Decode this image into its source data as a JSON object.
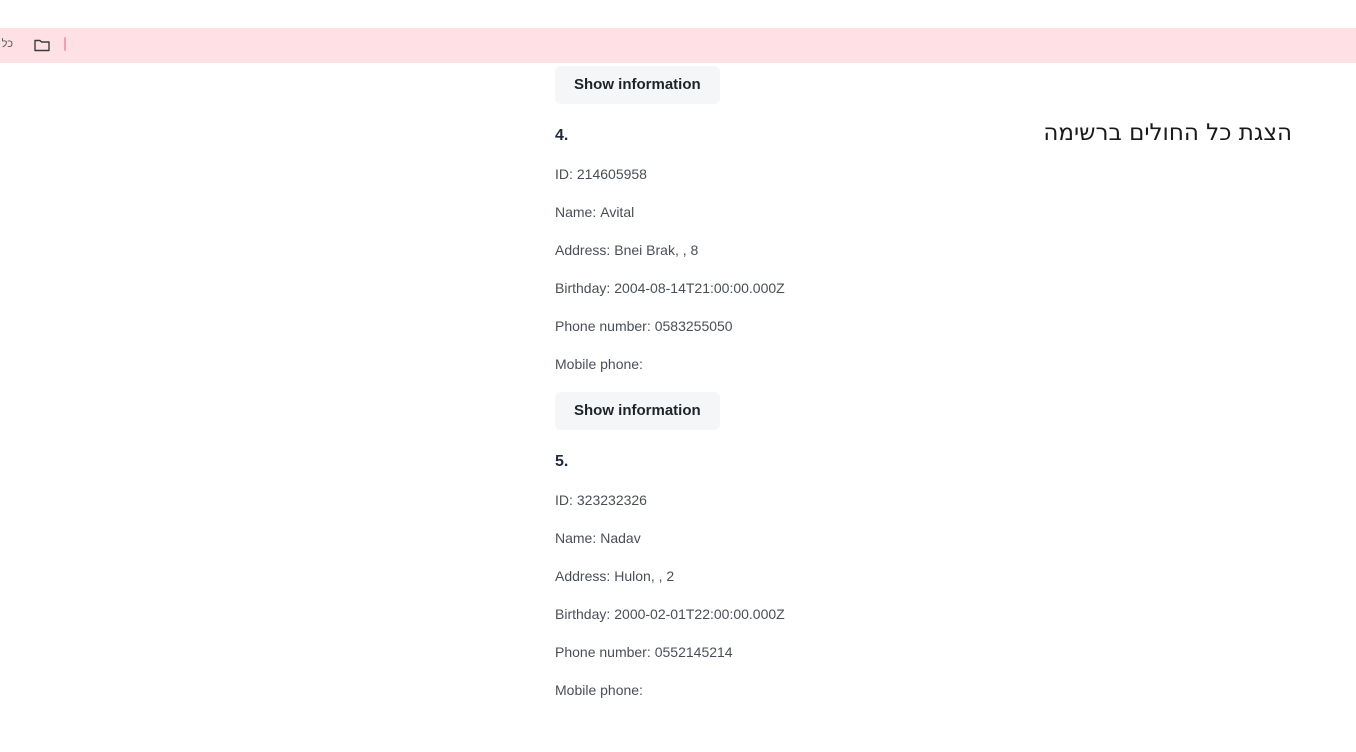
{
  "bookmarks_bar": {
    "folder_label": "כל ה",
    "colors": {
      "background": "#ffe0e5",
      "separator": "#f2a0b0"
    }
  },
  "page": {
    "title": "הצגת כל החולים ברשימה"
  },
  "labels": {
    "id": "ID:",
    "name": "Name:",
    "address": "Address:",
    "birthday": "Birthday:",
    "phone": "Phone number:",
    "mobile": "Mobile phone:",
    "show_button": "Show information"
  },
  "patients": [
    {
      "number": "4.",
      "id": "214605958",
      "name": "Avital",
      "address": "Bnei Brak, , 8",
      "birthday": "2004-08-14T21:00:00.000Z",
      "phone": "0583255050",
      "mobile": ""
    },
    {
      "number": "5.",
      "id": "323232326",
      "name": "Nadav",
      "address": "Hulon, , 2",
      "birthday": "2000-02-01T22:00:00.000Z",
      "phone": "0552145214",
      "mobile": ""
    }
  ]
}
